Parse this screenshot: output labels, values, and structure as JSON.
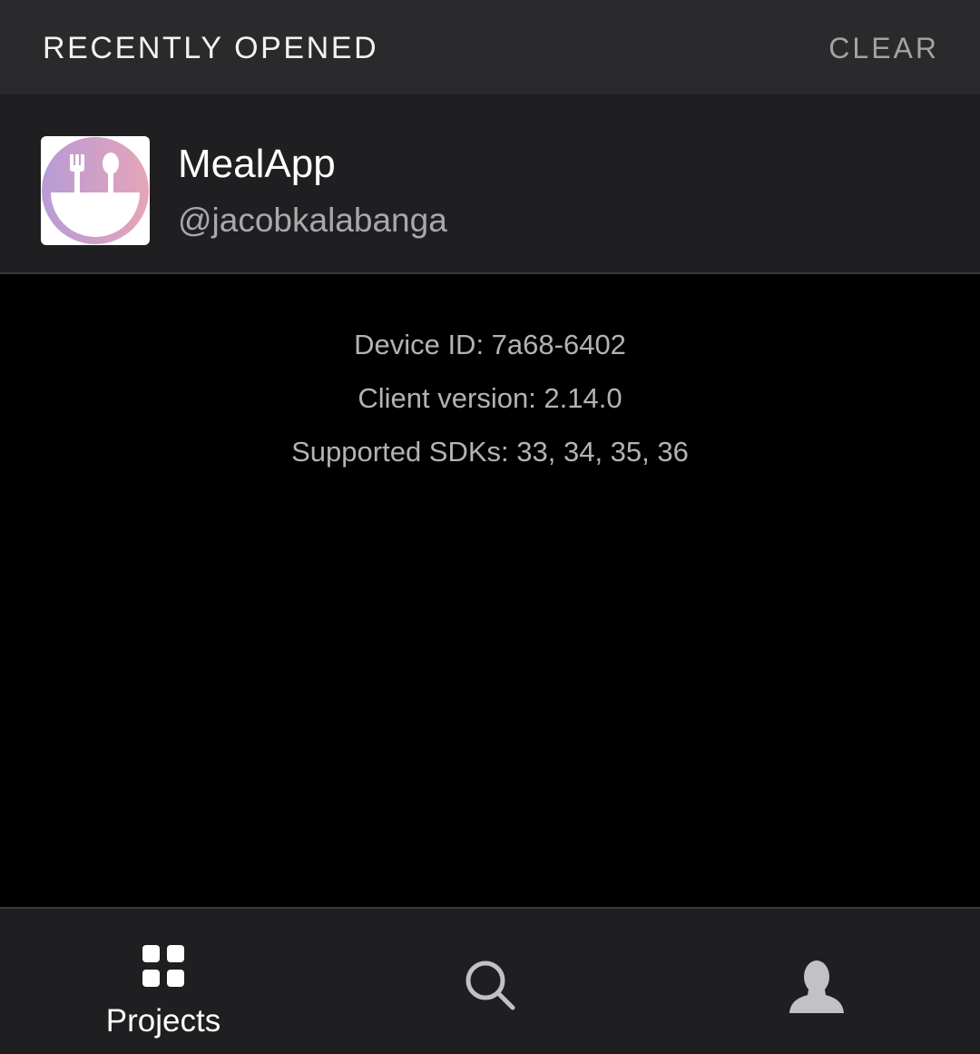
{
  "recent": {
    "title": "RECENTLY OPENED",
    "clear_label": "CLEAR"
  },
  "project": {
    "name": "MealApp",
    "owner": "@jacobkalabanga",
    "icon": "fork-spoon-bowl-icon",
    "icon_gradient": [
      "#b79bd6",
      "#e7a4b8"
    ]
  },
  "device": {
    "device_id": "Device ID: 7a68-6402",
    "client_version": "Client version: 2.14.0",
    "supported_sdks": "Supported SDKs: 33, 34, 35, 36"
  },
  "tabs": [
    {
      "label": "Projects",
      "icon": "grid-icon",
      "active": true
    },
    {
      "label": "",
      "icon": "search-icon",
      "active": false
    },
    {
      "label": "",
      "icon": "profile-icon",
      "active": false
    }
  ],
  "colors": {
    "background": "#000000",
    "header_bg": "#2a2a2c",
    "row_bg": "#1f1f21",
    "muted_text": "#a9a9ab",
    "active_icon": "#ffffff",
    "inactive_icon": "#c2c2c4"
  }
}
